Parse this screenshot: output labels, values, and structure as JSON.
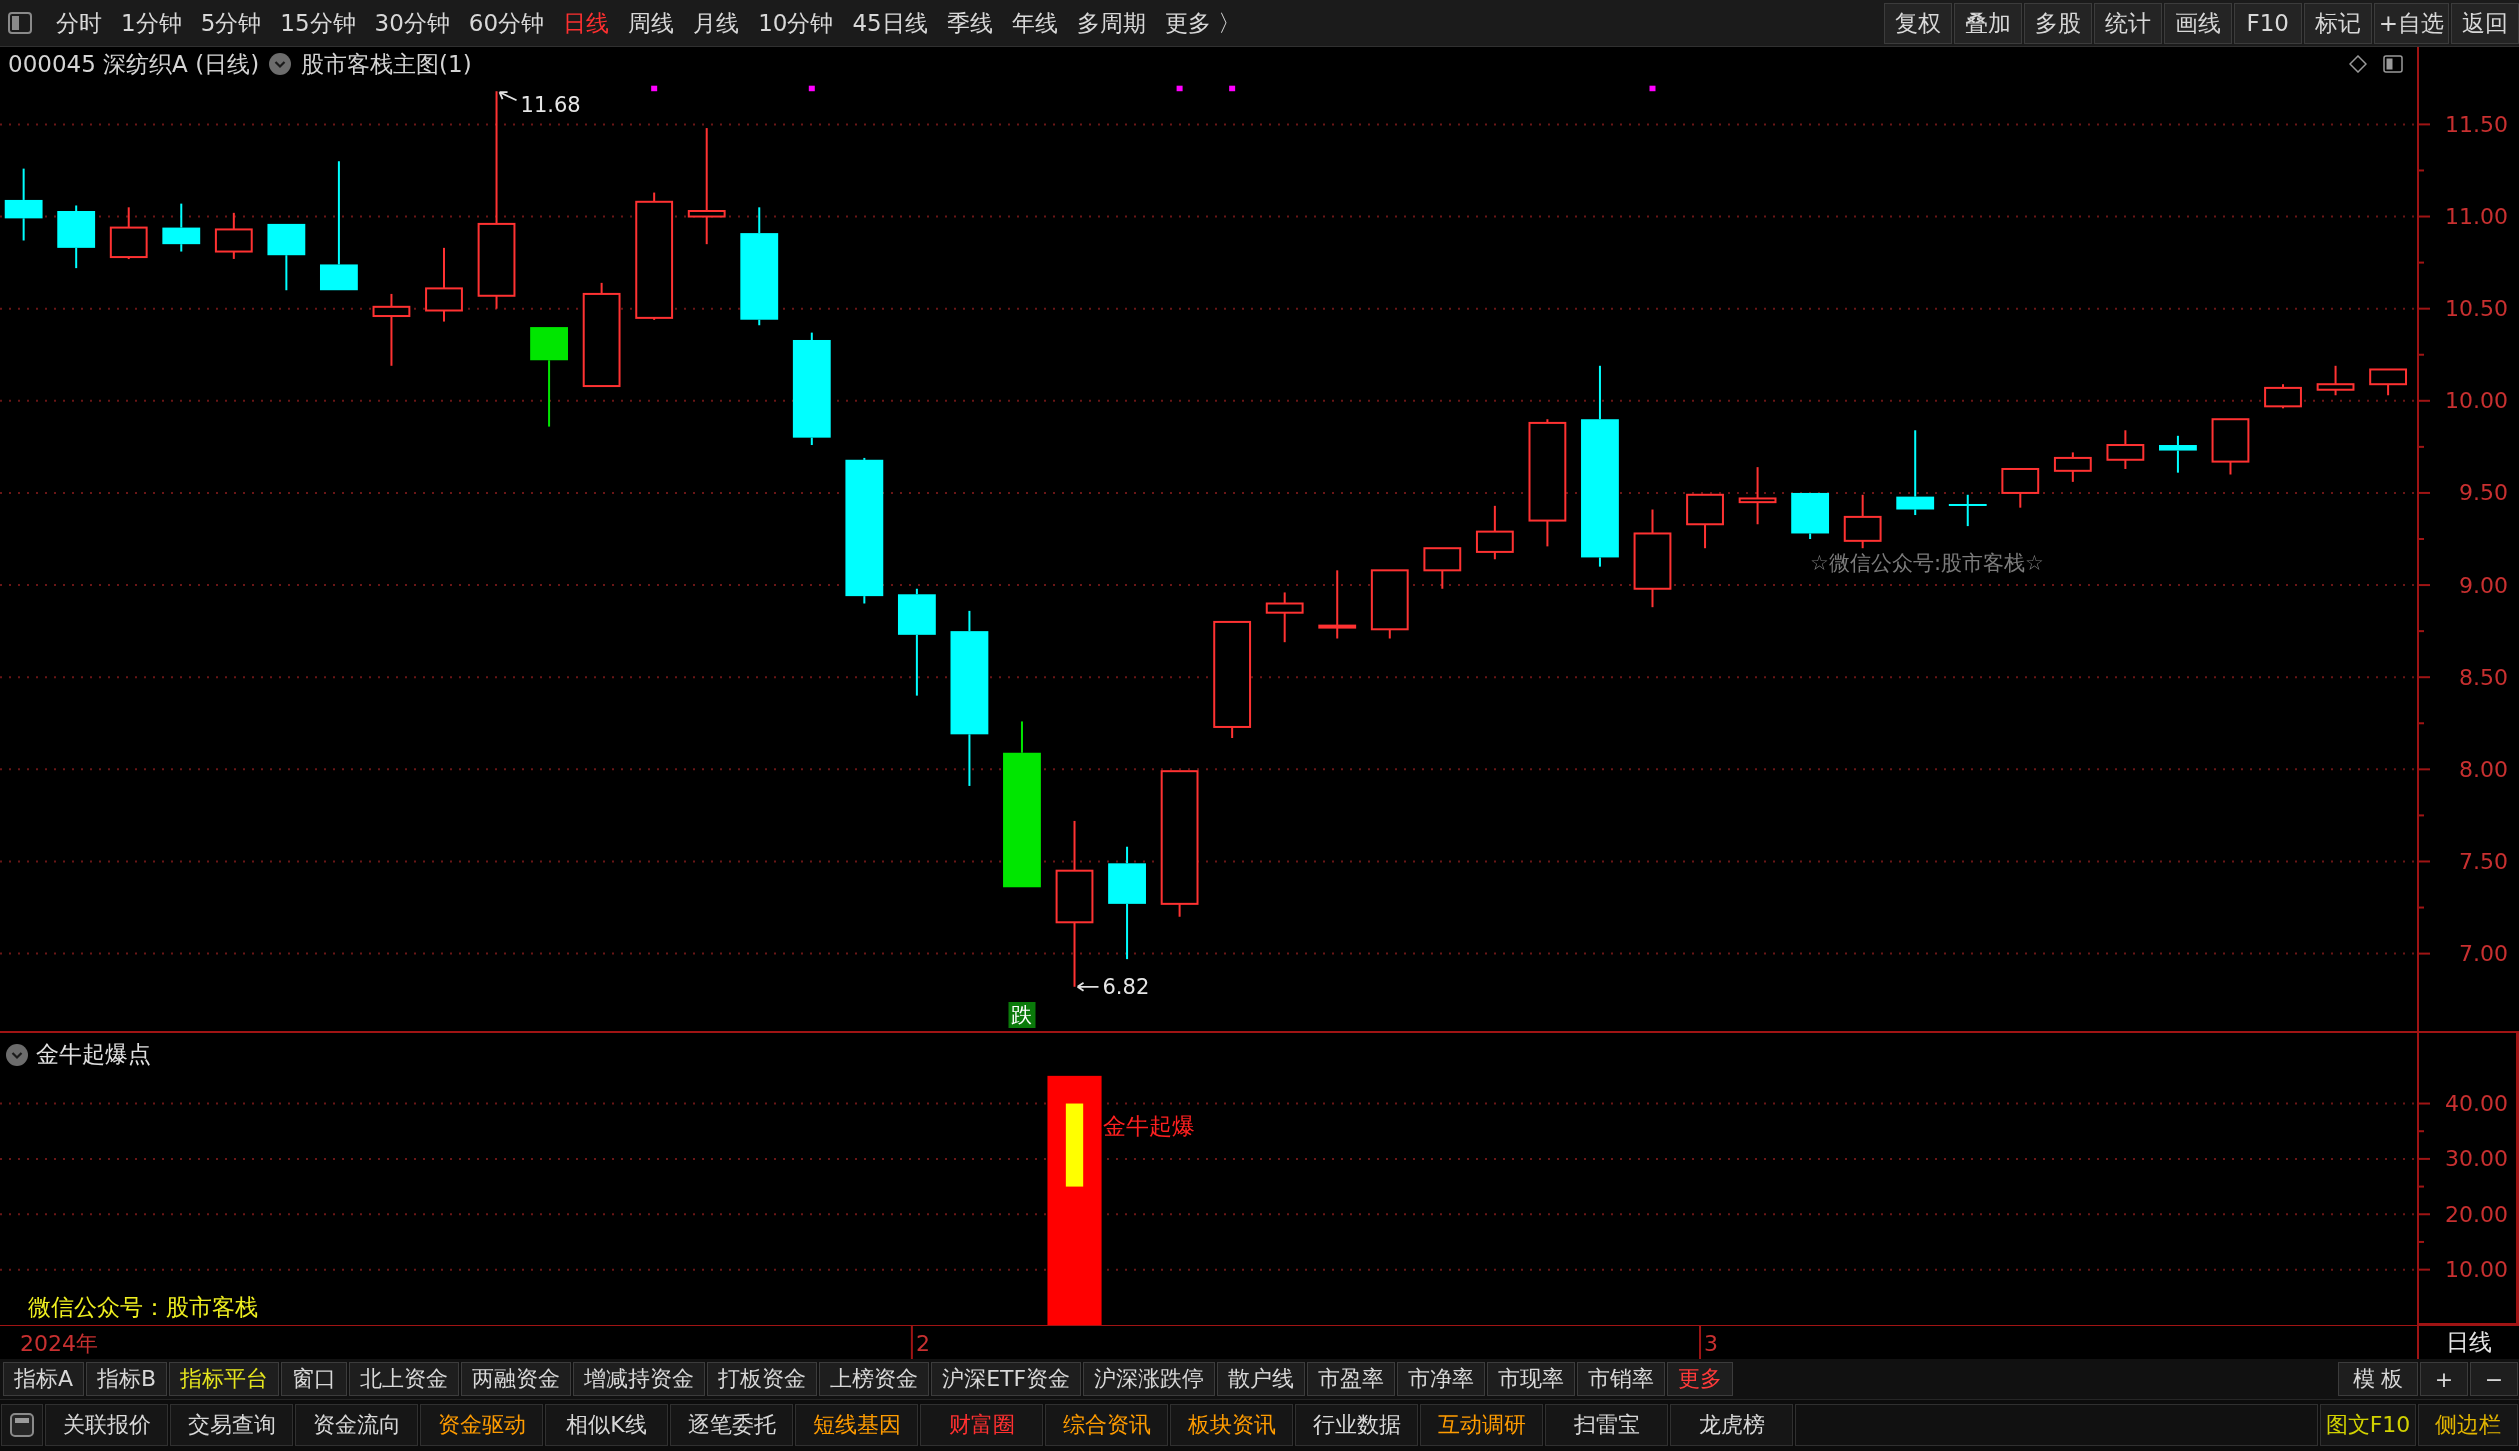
{
  "toolbar": {
    "periods": [
      {
        "label": "分时",
        "selected": false
      },
      {
        "label": "1分钟",
        "selected": false
      },
      {
        "label": "5分钟",
        "selected": false
      },
      {
        "label": "15分钟",
        "selected": false
      },
      {
        "label": "30分钟",
        "selected": false
      },
      {
        "label": "60分钟",
        "selected": false
      },
      {
        "label": "日线",
        "selected": true
      },
      {
        "label": "周线",
        "selected": false
      },
      {
        "label": "月线",
        "selected": false
      },
      {
        "label": "10分钟",
        "selected": false
      },
      {
        "label": "45日线",
        "selected": false
      },
      {
        "label": "季线",
        "selected": false
      },
      {
        "label": "年线",
        "selected": false
      },
      {
        "label": "多周期",
        "selected": false
      },
      {
        "label": "更多 〉",
        "selected": false
      }
    ],
    "buttons": [
      "复权",
      "叠加",
      "多股",
      "统计",
      "画线",
      "F10",
      "标记",
      "+自选",
      "返回"
    ]
  },
  "main_chart": {
    "title": "000045 深纺织A (日线)",
    "indicator": "股市客栈主图(1)",
    "chart_data": {
      "type": "bar",
      "grid": true,
      "ylim": [
        6.58,
        11.92
      ],
      "yticks": [
        {
          "value": 11.5,
          "label": "11.50"
        },
        {
          "value": 11,
          "label": "11.00"
        },
        {
          "value": 10.5,
          "label": "10.50"
        },
        {
          "value": 10,
          "label": "10.00"
        },
        {
          "value": 9.5,
          "label": "9.50"
        },
        {
          "value": 9,
          "label": "9.00"
        },
        {
          "value": 8.5,
          "label": "8.50"
        },
        {
          "value": 8,
          "label": "8.00"
        },
        {
          "value": 7.5,
          "label": "7.50"
        },
        {
          "value": 7,
          "label": "7.00"
        }
      ],
      "series": [
        {
          "color": "#ff3232",
          "base": [
            null,
            null,
            10.78,
            null,
            10.81,
            null,
            null,
            10.46,
            10.49,
            10.57,
            null,
            10.08,
            10.45,
            11.0,
            null,
            null,
            null,
            null,
            null,
            null,
            7.17,
            null,
            7.27,
            8.23,
            8.85,
            8.77,
            8.76,
            9.08,
            9.18,
            9.35,
            null,
            8.98,
            9.33,
            9.45,
            null,
            9.24,
            null,
            null,
            9.5,
            9.62,
            9.68,
            null,
            9.67,
            9.97,
            10.06,
            10.09
          ],
          "values": [
            null,
            null,
            0.16,
            null,
            0.12,
            null,
            null,
            0.05,
            0.12,
            0.39,
            null,
            0.5,
            0.63,
            0.03,
            null,
            null,
            null,
            null,
            null,
            null,
            0.28,
            null,
            0.72,
            0.57,
            0.05,
            0.01,
            0.32,
            0.12,
            0.11,
            0.53,
            null,
            0.3,
            0.16,
            0.02,
            null,
            0.13,
            null,
            null,
            0.13,
            0.07,
            0.08,
            null,
            0.23,
            0.1,
            0.03,
            0.08
          ]
        },
        {
          "color": "#00ffff",
          "base": [
            10.99,
            10.83,
            null,
            10.85,
            null,
            10.79,
            10.6,
            null,
            null,
            null,
            null,
            null,
            null,
            null,
            10.44,
            9.8,
            8.94,
            8.73,
            8.19,
            null,
            null,
            7.27,
            null,
            null,
            null,
            null,
            null,
            null,
            null,
            null,
            9.15,
            null,
            null,
            null,
            9.28,
            null,
            9.41,
            9.43,
            null,
            null,
            null,
            9.73,
            null,
            null,
            null,
            null
          ],
          "values": [
            0.1,
            0.2,
            null,
            0.09,
            null,
            0.17,
            0.14,
            null,
            null,
            null,
            null,
            null,
            null,
            null,
            0.47,
            0.53,
            0.74,
            0.22,
            0.56,
            null,
            null,
            0.22,
            null,
            null,
            null,
            null,
            null,
            null,
            null,
            null,
            0.75,
            null,
            null,
            null,
            0.22,
            null,
            0.07,
            0.01,
            null,
            null,
            null,
            0.03,
            null,
            null,
            null,
            null
          ]
        },
        {
          "color": "#00e600",
          "base": [
            null,
            null,
            null,
            null,
            null,
            null,
            null,
            null,
            null,
            null,
            10.22,
            null,
            null,
            null,
            null,
            null,
            null,
            null,
            null,
            7.36,
            null,
            null,
            null,
            null,
            null,
            null,
            null,
            null,
            null,
            null,
            null,
            null,
            null,
            null,
            null,
            null,
            null,
            null,
            null,
            null,
            null,
            null,
            null,
            null,
            null,
            null
          ],
          "values": [
            null,
            null,
            null,
            null,
            null,
            null,
            null,
            null,
            null,
            null,
            0.18,
            null,
            null,
            null,
            null,
            null,
            null,
            null,
            null,
            0.73,
            null,
            null,
            null,
            null,
            null,
            null,
            null,
            null,
            null,
            null,
            null,
            null,
            null,
            null,
            null,
            null,
            null,
            null,
            null,
            null,
            null,
            null,
            null,
            null,
            null,
            null
          ]
        },
        {
          "color": "#ff3232",
          "base": [
            null,
            null,
            10.94,
            null,
            10.93,
            null,
            null,
            10.51,
            10.61,
            10.96,
            null,
            10.58,
            11.08,
            11.03,
            null,
            null,
            null,
            null,
            null,
            null,
            7.45,
            null,
            null,
            null,
            8.9,
            8.78,
            null,
            null,
            9.29,
            9.88,
            null,
            9.28,
            null,
            9.47,
            null,
            9.37,
            null,
            null,
            null,
            9.69,
            9.76,
            null,
            null,
            10.07,
            10.09,
            null
          ],
          "values": [
            null,
            null,
            0.11,
            null,
            0.09,
            null,
            null,
            0.07,
            0.22,
            0.72,
            null,
            0.06,
            0.05,
            0.45,
            null,
            null,
            null,
            null,
            null,
            null,
            0.27,
            null,
            null,
            null,
            0.06,
            0.3,
            null,
            null,
            0.14,
            0.02,
            null,
            0.13,
            null,
            0.17,
            null,
            0.12,
            null,
            null,
            null,
            0.03,
            0.08,
            null,
            null,
            0.02,
            0.1,
            null
          ]
        },
        {
          "color": "#ff3232",
          "base": [
            null,
            null,
            10.77,
            null,
            10.77,
            null,
            null,
            10.19,
            10.43,
            10.5,
            null,
            null,
            10.44,
            10.85,
            null,
            null,
            null,
            null,
            null,
            null,
            6.82,
            null,
            7.2,
            8.17,
            8.69,
            8.71,
            8.71,
            8.98,
            9.14,
            9.21,
            null,
            8.88,
            9.2,
            9.33,
            null,
            9.2,
            null,
            null,
            9.42,
            9.56,
            9.63,
            null,
            9.6,
            9.96,
            10.03,
            10.03
          ],
          "values": [
            null,
            null,
            0.01,
            null,
            0.04,
            null,
            null,
            0.27,
            0.06,
            0.07,
            null,
            null,
            0.01,
            0.15,
            null,
            null,
            null,
            null,
            null,
            null,
            0.35,
            null,
            0.07,
            0.06,
            0.16,
            0.06,
            0.05,
            0.1,
            0.04,
            0.14,
            null,
            0.1,
            0.13,
            0.12,
            null,
            0.04,
            null,
            null,
            0.08,
            0.06,
            0.05,
            null,
            0.07,
            0.01,
            0.03,
            0.06
          ]
        },
        {
          "color": "#00ffff",
          "base": [
            11.09,
            11.03,
            null,
            10.94,
            null,
            null,
            10.74,
            null,
            null,
            null,
            null,
            null,
            null,
            null,
            10.91,
            10.33,
            9.68,
            8.95,
            8.75,
            null,
            null,
            7.49,
            null,
            null,
            null,
            null,
            null,
            null,
            null,
            null,
            9.9,
            null,
            null,
            null,
            null,
            null,
            9.48,
            9.44,
            null,
            null,
            null,
            9.76,
            null,
            null,
            null,
            null
          ],
          "values": [
            0.17,
            0.03,
            null,
            0.13,
            null,
            null,
            0.56,
            null,
            null,
            null,
            null,
            null,
            null,
            null,
            0.14,
            0.04,
            0.01,
            0.03,
            0.11,
            null,
            null,
            0.09,
            null,
            null,
            null,
            null,
            null,
            null,
            null,
            null,
            0.29,
            null,
            null,
            null,
            null,
            null,
            0.36,
            0.05,
            null,
            null,
            null,
            0.05,
            null,
            null,
            null,
            null
          ]
        },
        {
          "color": "#00ffff",
          "base": [
            10.87,
            10.72,
            null,
            10.81,
            null,
            10.6,
            null,
            null,
            null,
            null,
            null,
            null,
            null,
            null,
            10.41,
            9.76,
            8.9,
            8.4,
            7.91,
            null,
            null,
            6.97,
            null,
            null,
            null,
            null,
            null,
            null,
            null,
            null,
            9.1,
            null,
            null,
            null,
            9.25,
            null,
            9.38,
            9.32,
            null,
            null,
            null,
            9.61,
            null,
            null,
            null,
            null
          ],
          "values": [
            0.12,
            0.11,
            null,
            0.04,
            null,
            0.19,
            null,
            null,
            null,
            null,
            null,
            null,
            null,
            null,
            0.03,
            0.04,
            0.04,
            0.33,
            0.28,
            null,
            null,
            0.3,
            null,
            null,
            null,
            null,
            null,
            null,
            null,
            null,
            0.05,
            null,
            null,
            null,
            0.03,
            null,
            0.03,
            0.11,
            null,
            null,
            null,
            0.12,
            null,
            null,
            null,
            null
          ]
        },
        {
          "color": "#00e600",
          "base": [
            null,
            null,
            null,
            null,
            null,
            null,
            null,
            null,
            null,
            null,
            null,
            null,
            null,
            null,
            null,
            null,
            null,
            null,
            null,
            8.09,
            null,
            null,
            null,
            null,
            null,
            null,
            null,
            null,
            null,
            null,
            null,
            null,
            null,
            null,
            null,
            null,
            null,
            null,
            null,
            null,
            null,
            null,
            null,
            null,
            null,
            null
          ],
          "values": [
            null,
            null,
            null,
            null,
            null,
            null,
            null,
            null,
            null,
            null,
            null,
            null,
            null,
            null,
            null,
            null,
            null,
            null,
            null,
            0.17,
            null,
            null,
            null,
            null,
            null,
            null,
            null,
            null,
            null,
            null,
            null,
            null,
            null,
            null,
            null,
            null,
            null,
            null,
            null,
            null,
            null,
            null,
            null,
            null,
            null,
            null
          ]
        },
        {
          "color": "#00e600",
          "base": [
            null,
            null,
            null,
            null,
            null,
            null,
            null,
            null,
            null,
            null,
            9.86,
            null,
            null,
            null,
            null,
            null,
            null,
            null,
            null,
            null,
            null,
            null,
            null,
            null,
            null,
            null,
            null,
            null,
            null,
            null,
            null,
            null,
            null,
            null,
            null,
            null,
            null,
            null,
            null,
            null,
            null,
            null,
            null,
            null,
            null,
            null
          ],
          "values": [
            null,
            null,
            null,
            null,
            null,
            null,
            null,
            null,
            null,
            null,
            0.36,
            null,
            null,
            null,
            null,
            null,
            null,
            null,
            null,
            null,
            null,
            null,
            null,
            null,
            null,
            null,
            null,
            null,
            null,
            null,
            null,
            null,
            null,
            null,
            null,
            null,
            null,
            null,
            null,
            null,
            null,
            null,
            null,
            null,
            null,
            null
          ]
        },
        {
          "color": "#ff00ff",
          "base": [
            null,
            null,
            null,
            null,
            null,
            null,
            null,
            null,
            null,
            null,
            null,
            null,
            11.68,
            null,
            null,
            11.68,
            null,
            null,
            null,
            null,
            null,
            null,
            11.68,
            11.68,
            null,
            null,
            null,
            null,
            null,
            null,
            null,
            11.68,
            null,
            null,
            null,
            null,
            null,
            null,
            null,
            null,
            null,
            null,
            null,
            null,
            null,
            null
          ],
          "values": [
            null,
            null,
            null,
            null,
            null,
            null,
            null,
            null,
            null,
            null,
            null,
            null,
            0.03,
            null,
            null,
            0.03,
            null,
            null,
            null,
            null,
            null,
            null,
            0.03,
            0.03,
            null,
            null,
            null,
            null,
            null,
            null,
            null,
            0.03,
            null,
            null,
            null,
            null,
            null,
            null,
            null,
            null,
            null,
            null,
            null,
            null,
            null,
            null
          ]
        }
      ],
      "annotations": [
        "11.68",
        "6.82",
        "跌",
        "☆微信公众号:股市客栈☆"
      ]
    }
  },
  "indicator_panel": {
    "title": "金牛起爆点",
    "footer": "微信公众号：股市客栈",
    "chart_data": {
      "type": "bar",
      "grid": true,
      "ylim": [
        0,
        53.1
      ],
      "yticks": [
        {
          "value": 40,
          "label": "40.00"
        },
        {
          "value": 30,
          "label": "30.00"
        },
        {
          "value": 20,
          "label": "20.00"
        },
        {
          "value": 10,
          "label": "10.00"
        }
      ],
      "series": [
        {
          "color": "#ff0000",
          "values": [
            null,
            null,
            null,
            null,
            null,
            null,
            null,
            null,
            null,
            null,
            null,
            null,
            null,
            null,
            null,
            null,
            null,
            null,
            null,
            null,
            45,
            null,
            null,
            null,
            null,
            null,
            null,
            null,
            null,
            null,
            null,
            null,
            null,
            null,
            null,
            null,
            null,
            null,
            null,
            null,
            null,
            null,
            null,
            null,
            null,
            null
          ]
        },
        {
          "color": "#ffff00",
          "base": [
            null,
            null,
            null,
            null,
            null,
            null,
            null,
            null,
            null,
            null,
            null,
            null,
            null,
            null,
            null,
            null,
            null,
            null,
            null,
            null,
            25,
            null,
            null,
            null,
            null,
            null,
            null,
            null,
            null,
            null,
            null,
            null,
            null,
            null,
            null,
            null,
            null,
            null,
            null,
            null,
            null,
            null,
            null,
            null,
            null,
            null
          ],
          "values": [
            null,
            null,
            null,
            null,
            null,
            null,
            null,
            null,
            null,
            null,
            null,
            null,
            null,
            null,
            null,
            null,
            null,
            null,
            null,
            null,
            15,
            null,
            null,
            null,
            null,
            null,
            null,
            null,
            null,
            null,
            null,
            null,
            null,
            null,
            null,
            null,
            null,
            null,
            null,
            null,
            null,
            null,
            null,
            null,
            null,
            null
          ]
        }
      ],
      "annotations": [
        "金牛起爆"
      ]
    }
  },
  "date_axis": {
    "labels": [
      "2024年",
      "2",
      "3"
    ],
    "period": "日线"
  },
  "indicator_tabs": {
    "items": [
      {
        "label": "指标A",
        "color": "#d8d8d8"
      },
      {
        "label": "指标B",
        "color": "#d8d8d8"
      },
      {
        "label": "指标平台",
        "color": "#e6e61e"
      },
      {
        "label": "窗口",
        "color": "#d8d8d8"
      },
      {
        "label": "北上资金",
        "color": "#d8d8d8"
      },
      {
        "label": "两融资金",
        "color": "#d8d8d8"
      },
      {
        "label": "增减持资金",
        "color": "#d8d8d8"
      },
      {
        "label": "打板资金",
        "color": "#d8d8d8"
      },
      {
        "label": "上榜资金",
        "color": "#d8d8d8"
      },
      {
        "label": "沪深ETF资金",
        "color": "#d8d8d8"
      },
      {
        "label": "沪深涨跌停",
        "color": "#d8d8d8"
      },
      {
        "label": "散户线",
        "color": "#d8d8d8"
      },
      {
        "label": "市盈率",
        "color": "#d8d8d8"
      },
      {
        "label": "市净率",
        "color": "#d8d8d8"
      },
      {
        "label": "市现率",
        "color": "#d8d8d8"
      },
      {
        "label": "市销率",
        "color": "#d8d8d8"
      },
      {
        "label": "更多",
        "color": "#ff3a3a"
      }
    ],
    "buttons": [
      "模 板",
      "+",
      "−"
    ]
  },
  "function_bar": {
    "items": [
      {
        "label": "关联报价",
        "color": "#d8d8d8"
      },
      {
        "label": "交易查询",
        "color": "#d8d8d8"
      },
      {
        "label": "资金流向",
        "color": "#d8d8d8"
      },
      {
        "label": "资金驱动",
        "color": "#ff9c00"
      },
      {
        "label": "相似K线",
        "color": "#d8d8d8"
      },
      {
        "label": "逐笔委托",
        "color": "#d8d8d8"
      },
      {
        "label": "短线基因",
        "color": "#ff9c00"
      },
      {
        "label": "财富圈",
        "color": "#ff3030"
      },
      {
        "label": "综合资讯",
        "color": "#ff9c00"
      },
      {
        "label": "板块资讯",
        "color": "#ff9c00"
      },
      {
        "label": "行业数据",
        "color": "#d8d8d8"
      },
      {
        "label": "互动调研",
        "color": "#ff9c00"
      },
      {
        "label": "扫雷宝",
        "color": "#d8d8d8"
      },
      {
        "label": "龙虎榜",
        "color": "#d8d8d8"
      }
    ],
    "right_items": [
      {
        "label": "图文F10",
        "color": "#d2d200"
      },
      {
        "label": "侧边栏",
        "color": "#e0b400"
      }
    ]
  }
}
